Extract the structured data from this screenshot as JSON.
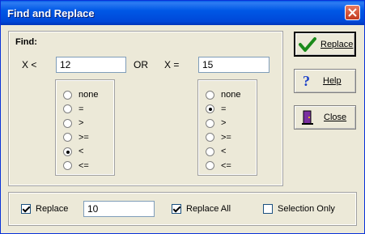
{
  "window": {
    "title": "Find and Replace"
  },
  "find": {
    "label": "Find:",
    "left_var": "X <",
    "left_value": "12",
    "connector": "OR",
    "right_var": "X =",
    "right_value": "15"
  },
  "left_options": {
    "items": [
      "none",
      "=",
      ">",
      ">=",
      "<",
      "<="
    ],
    "selected": "<"
  },
  "right_options": {
    "items": [
      "none",
      "=",
      ">",
      ">=",
      "<",
      "<="
    ],
    "selected": "="
  },
  "buttons": {
    "replace": "Replace",
    "help": "Help",
    "close": "Close"
  },
  "bottom": {
    "replace_label": "Replace",
    "replace_checked": true,
    "replace_value": "10",
    "replace_all_label": "Replace All",
    "replace_all_checked": true,
    "selection_only_label": "Selection Only",
    "selection_only_checked": false
  },
  "colors": {
    "titlebar": "#0058e6",
    "face": "#ece9d8",
    "check": "#1a8a1a",
    "help": "#1a3fc8"
  }
}
